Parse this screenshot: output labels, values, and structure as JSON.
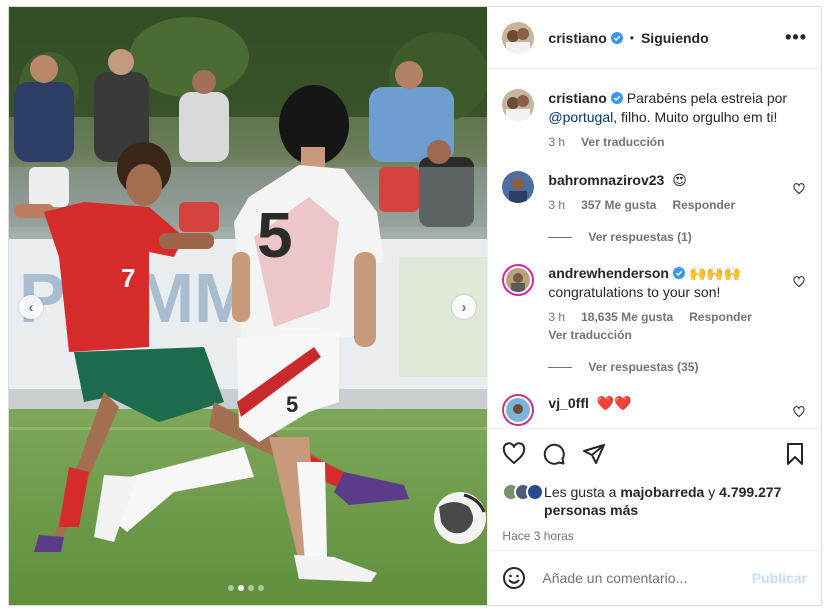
{
  "post": {
    "author": "cristiano",
    "follow_state": "Siguiendo",
    "separator": "•",
    "more_label": "•••",
    "caption_prefix": "Parabéns pela estreia por",
    "caption_mention": "@portugal",
    "caption_suffix": ", filho. Muito orgulho em ti!",
    "caption_time": "3 h",
    "caption_translate": "Ver traducción"
  },
  "photo": {
    "prev_label": "‹",
    "next_label": "›",
    "slides": 4,
    "active_slide": 2,
    "player_left_number": "7",
    "player_right_number": "5",
    "player_right_shorts_number": "5"
  },
  "comments": [
    {
      "user": "bahromnazirov23",
      "text": "😍",
      "time": "3 h",
      "likes": "357 Me gusta",
      "reply": "Responder",
      "replies": "Ver respuestas (1)"
    },
    {
      "user": "andrewhenderson",
      "verified": true,
      "text": "🙌🙌🙌 congratulations to your son!",
      "time": "3 h",
      "likes": "18,635 Me gusta",
      "reply": "Responder",
      "translate": "Ver traducción",
      "replies": "Ver respuestas (35)"
    },
    {
      "user": "vj_0ffl",
      "text": "❤️❤️"
    }
  ],
  "likes": {
    "prefix": "Les gusta a",
    "first_user": "majobarreda",
    "joiner": "y",
    "count": "4.799.277",
    "suffix": "personas más"
  },
  "time_ago": "Hace 3 horas",
  "add_comment": {
    "placeholder": "Añade un comentario...",
    "publish": "Publicar"
  },
  "colors": {
    "accent": "#0095f6",
    "verified": "#3897f0",
    "publish_disabled": "#c0dffd",
    "muted_text": "#737373",
    "mention": "#00376b"
  },
  "icons": {
    "like": "heart-icon",
    "comment": "comment-icon",
    "share": "share-icon",
    "save": "bookmark-icon",
    "emoji": "emoji-icon",
    "verified": "verified-badge-icon",
    "more": "more-options-icon"
  }
}
